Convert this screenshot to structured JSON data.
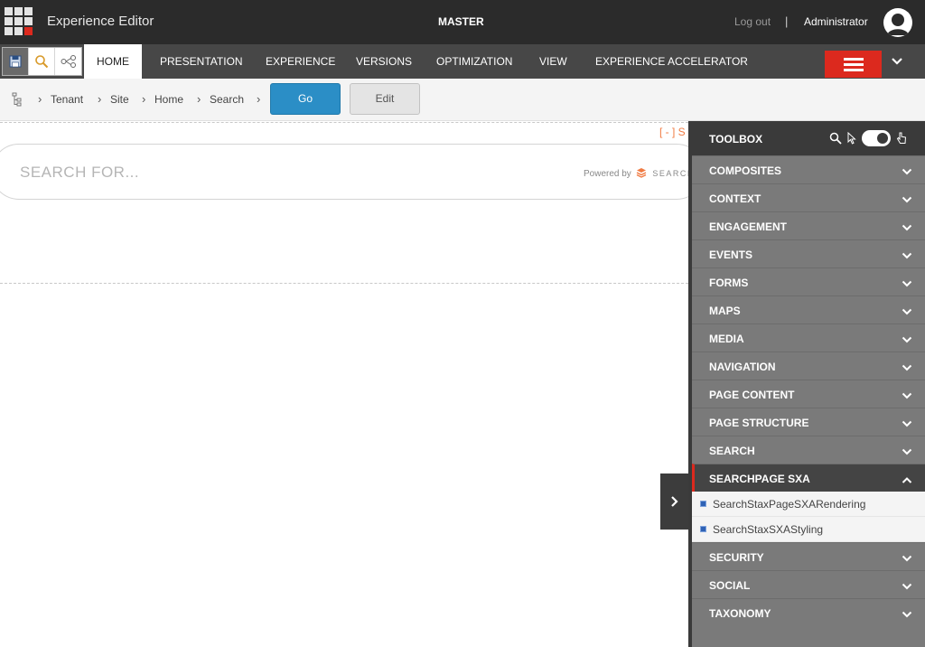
{
  "topbar": {
    "app_title": "Experience Editor",
    "database": "MASTER",
    "logout": "Log out",
    "separator": "|",
    "user": "Administrator"
  },
  "quick_actions": [
    {
      "icon": "save-icon"
    },
    {
      "icon": "search-icon"
    },
    {
      "icon": "share-icon"
    }
  ],
  "ribbon": {
    "tabs": [
      {
        "label": "HOME",
        "active": true
      },
      {
        "label": "PRESENTATION",
        "active": false
      },
      {
        "label": "EXPERIENCE",
        "active": false
      },
      {
        "label": "VERSIONS",
        "active": false
      },
      {
        "label": "OPTIMIZATION",
        "active": false
      },
      {
        "label": "VIEW",
        "active": false
      },
      {
        "label": "EXPERIENCE ACCELERATOR",
        "active": false
      }
    ]
  },
  "breadcrumb": {
    "items": [
      "Tenant",
      "Site",
      "Home",
      "Search"
    ],
    "go_label": "Go",
    "edit_label": "Edit"
  },
  "canvas": {
    "component_marker": "[ - ] S",
    "search_placeholder": "SEARCH FOR...",
    "powered_by": "Powered by",
    "brand_text": "SEARCH"
  },
  "toolbox": {
    "title": "TOOLBOX",
    "sections": [
      {
        "label": "COMPOSITES",
        "expanded": false
      },
      {
        "label": "CONTEXT",
        "expanded": false
      },
      {
        "label": "ENGAGEMENT",
        "expanded": false
      },
      {
        "label": "EVENTS",
        "expanded": false
      },
      {
        "label": "FORMS",
        "expanded": false
      },
      {
        "label": "MAPS",
        "expanded": false
      },
      {
        "label": "MEDIA",
        "expanded": false
      },
      {
        "label": "NAVIGATION",
        "expanded": false
      },
      {
        "label": "PAGE CONTENT",
        "expanded": false
      },
      {
        "label": "PAGE STRUCTURE",
        "expanded": false
      },
      {
        "label": "SEARCH",
        "expanded": false
      },
      {
        "label": "SEARCHPAGE SXA",
        "expanded": true,
        "items": [
          "SearchStaxPageSXARendering",
          "SearchStaxSXAStyling"
        ]
      },
      {
        "label": "SECURITY",
        "expanded": false
      },
      {
        "label": "SOCIAL",
        "expanded": false
      },
      {
        "label": "TAXONOMY",
        "expanded": false
      }
    ]
  },
  "colors": {
    "topbar": "#2b2b2b",
    "ribbon": "#474747",
    "accent_red": "#dc291e",
    "go_blue": "#2b8ec6",
    "toolbox_gray": "#7a7a7a",
    "marker_orange": "#f07b43"
  }
}
